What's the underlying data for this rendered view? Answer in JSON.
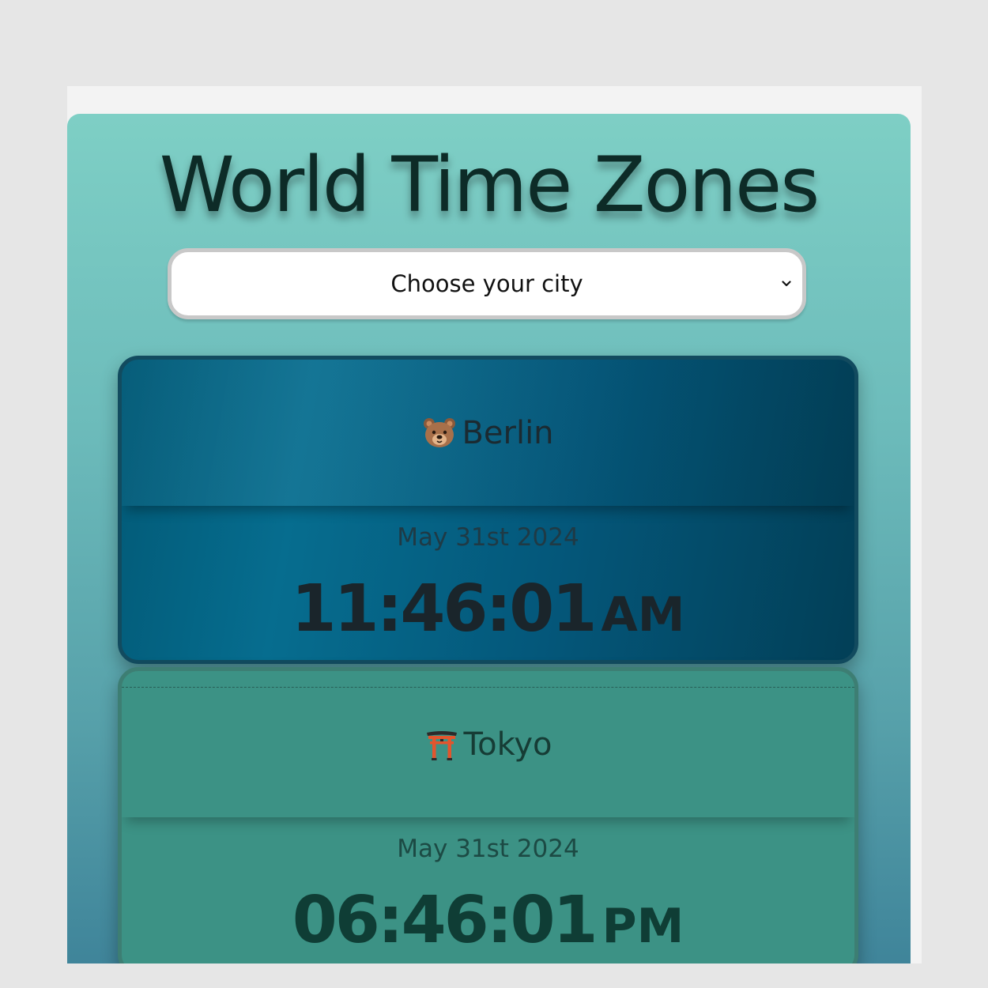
{
  "app": {
    "title": "World Time Zones"
  },
  "city_select": {
    "selected_label": "Choose your city"
  },
  "cities": [
    {
      "name": "Berlin",
      "icon": "bear-face-icon",
      "date": "May 31st 2024",
      "time": "11:46:01",
      "ampm": "AM"
    },
    {
      "name": "Tokyo",
      "icon": "torii-gate-icon",
      "date": "May 31st 2024",
      "time": "06:46:01",
      "ampm": "PM"
    }
  ],
  "colors": {
    "page_background": "#e6e6e6",
    "panel_gradient_top": "#7ecfc5",
    "panel_gradient_bottom": "#3e8399",
    "berlin_card": "#066d8f",
    "tokyo_card": "#3c9285",
    "title_text": "#0d2b27"
  }
}
